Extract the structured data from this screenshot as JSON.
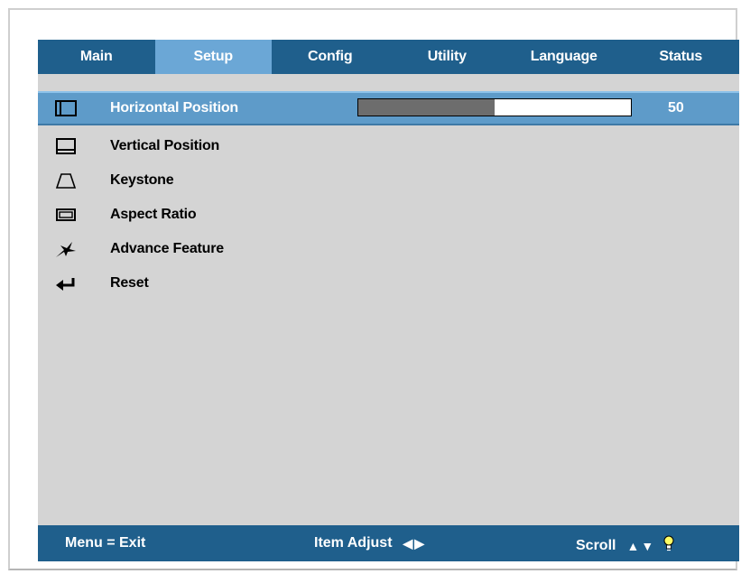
{
  "tabs": [
    {
      "label": "Main",
      "active": false
    },
    {
      "label": "Setup",
      "active": true
    },
    {
      "label": "Config",
      "active": false
    },
    {
      "label": "Utility",
      "active": false
    },
    {
      "label": "Language",
      "active": false
    },
    {
      "label": "Status",
      "active": false
    }
  ],
  "menu": {
    "items": [
      {
        "label": "Horizontal Position",
        "icon": "horizontal-position-icon",
        "selected": true
      },
      {
        "label": "Vertical Position",
        "icon": "vertical-position-icon",
        "selected": false
      },
      {
        "label": "Keystone",
        "icon": "keystone-icon",
        "selected": false
      },
      {
        "label": "Aspect Ratio",
        "icon": "aspect-ratio-icon",
        "selected": false
      },
      {
        "label": "Advance Feature",
        "icon": "advance-feature-icon",
        "selected": false
      },
      {
        "label": "Reset",
        "icon": "reset-icon",
        "selected": false
      }
    ]
  },
  "slider": {
    "value": "50",
    "fill_fraction": 0.5
  },
  "status": {
    "exit_label": "Menu = Exit",
    "adjust_label": "Item Adjust",
    "adjust_glyph": "◀▶",
    "scroll_label": "Scroll",
    "scroll_glyph": "▲▼"
  },
  "colors": {
    "bar": "#1f5f8c",
    "active_tab": "#6ba7d6",
    "selected_row": "#5e9bc9",
    "panel": "#d4d4d4",
    "slider_fill": "#6d6d6d"
  }
}
